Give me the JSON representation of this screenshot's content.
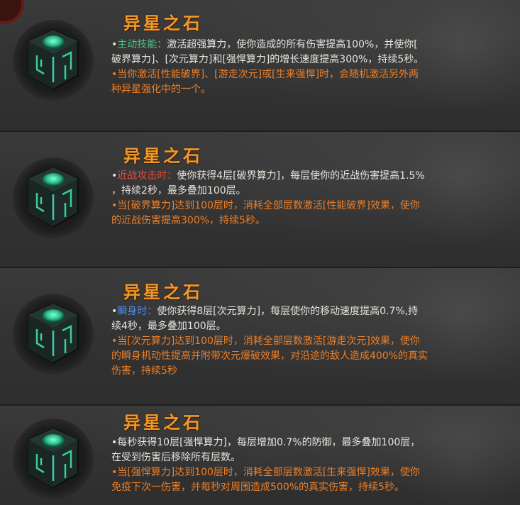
{
  "cards": [
    {
      "title": "异星之石",
      "icon": "alien-stone-cube-icon",
      "lines": [
        {
          "bullet": "•",
          "keyword": "主动技能：",
          "text": "激活超强算力，使你造成的所有伤害提高100%，并使你["
        },
        {
          "text": "破界算力]、[次元算力]和[强悍算力]的增长速度提高300%，持续5秒。"
        },
        {
          "text": "•当你激活[性能破界]、[游走次元]或[生来强悍]时，会随机激活另外两"
        },
        {
          "text": "种异星强化中的一个。"
        }
      ]
    },
    {
      "title": "异星之石",
      "icon": "alien-stone-cube-icon",
      "lines": [
        {
          "bullet": "•",
          "keyword": "近战攻击时：",
          "text": "使你获得4层[破界算力]，每层使你的近战伤害提高1.5%"
        },
        {
          "text": "，持续2秒，最多叠加100层。"
        },
        {
          "text": "•当[破界算力]达到100层时，消耗全部层数激活[性能破界]效果，使你"
        },
        {
          "text": "的近战伤害提高300%，持续5秒。"
        }
      ]
    },
    {
      "title": "异星之石",
      "icon": "alien-stone-cube-icon",
      "lines": [
        {
          "bullet": "•",
          "keyword": "瞬身时：",
          "text": "使你获得8层[次元算力]，每层使你的移动速度提高0.7%,持"
        },
        {
          "text": "续4秒，最多叠加100层。"
        },
        {
          "text": "•当[次元算力]达到100层时，消耗全部层数激活[游走次元]效果，使你"
        },
        {
          "text": "的瞬身机动性提高并附带次元爆破效果，对沿途的敌人造成400%的真实"
        },
        {
          "text": "伤害，持续5秒"
        }
      ]
    },
    {
      "title": "异星之石",
      "icon": "alien-stone-cube-icon",
      "lines": [
        {
          "text": "•每秒获得10层[强悍算力]，每层增加0.7%的防御，最多叠加100层，"
        },
        {
          "text": "在受到伤害后移除所有层数。"
        },
        {
          "text": "•当[强悍算力]达到100层时，消耗全部层数激活[生来强悍]效果，使你"
        },
        {
          "text": "免疫下次一伤害，并每秒对周围造成500%的真实伤害，持续5秒。"
        }
      ]
    }
  ],
  "colors": {
    "title": "#f19a2c",
    "body_text": "#e8e4dc",
    "orange_text": "#ef7f25",
    "keyword_active": "#47c67d",
    "keyword_melee": "#e04a3a",
    "keyword_blink": "#4c8fea",
    "background": "#2b2b2c",
    "icon_glow": "#3fe0a8"
  }
}
